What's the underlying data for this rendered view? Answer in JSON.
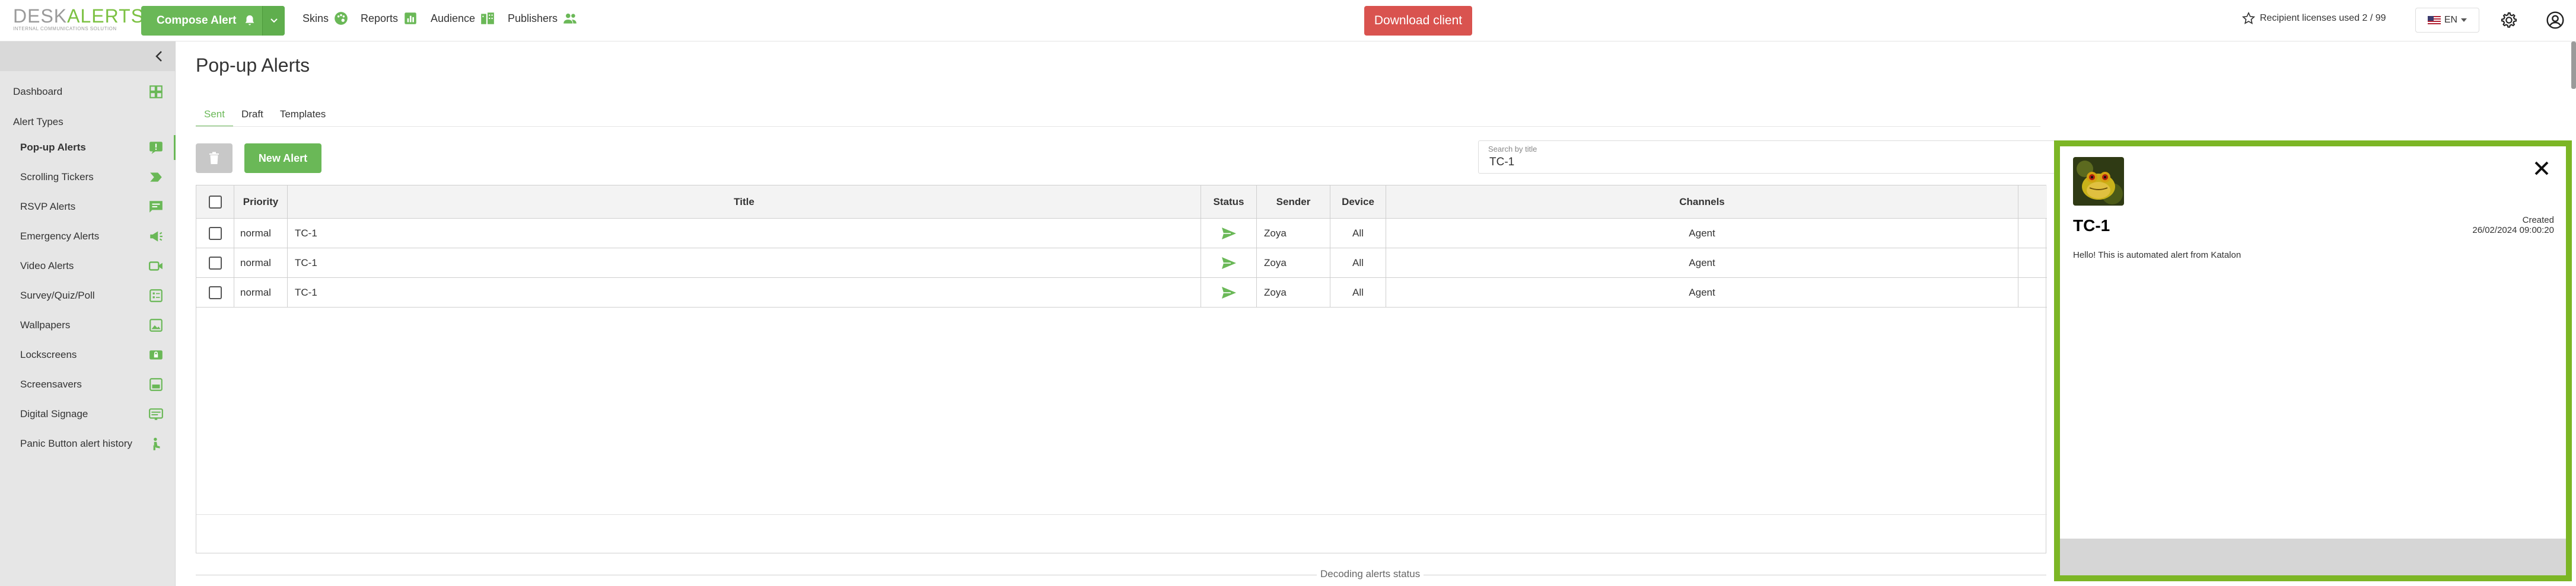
{
  "logo": {
    "desk": "DESK",
    "alerts": "ALERTS",
    "tagline": "INTERNAL COMMUNICATIONS SOLUTION"
  },
  "header": {
    "compose_label": "Compose Alert",
    "nav": [
      {
        "label": "Skins",
        "icon": "palette-icon"
      },
      {
        "label": "Reports",
        "icon": "chart-icon"
      },
      {
        "label": "Audience",
        "icon": "audience-icon"
      },
      {
        "label": "Publishers",
        "icon": "publishers-icon"
      }
    ],
    "download_label": "Download client",
    "licenses_label": "Recipient licenses used 2 / 99",
    "language": "EN",
    "colors": {
      "brand_green": "#6ab857",
      "download_red": "#d9534f",
      "popup_border": "#7cb625"
    }
  },
  "sidebar": {
    "dashboard": "Dashboard",
    "section_heading": "Alert Types",
    "items": [
      {
        "label": "Pop-up Alerts",
        "icon": "popup-alert-icon",
        "active": true
      },
      {
        "label": "Scrolling Tickers",
        "icon": "ticker-icon"
      },
      {
        "label": "RSVP Alerts",
        "icon": "rsvp-icon"
      },
      {
        "label": "Emergency Alerts",
        "icon": "megaphone-icon"
      },
      {
        "label": "Video Alerts",
        "icon": "video-icon"
      },
      {
        "label": "Survey/Quiz/Poll",
        "icon": "survey-icon"
      },
      {
        "label": "Wallpapers",
        "icon": "wallpaper-icon"
      },
      {
        "label": "Lockscreens",
        "icon": "lockscreen-icon"
      },
      {
        "label": "Screensavers",
        "icon": "screensaver-icon"
      },
      {
        "label": "Digital Signage",
        "icon": "signage-icon"
      },
      {
        "label": "Panic Button alert history",
        "icon": "panic-button-icon"
      }
    ]
  },
  "main": {
    "title": "Pop-up Alerts",
    "tabs": [
      {
        "label": "Sent",
        "active": true
      },
      {
        "label": "Draft"
      },
      {
        "label": "Templates"
      }
    ],
    "new_alert_label": "New Alert",
    "search": {
      "label": "Search by title",
      "value": "TC-1"
    },
    "table": {
      "columns": [
        "Priority",
        "Title",
        "Status",
        "Sender",
        "Device",
        "Channels"
      ],
      "rows": [
        {
          "priority": "normal",
          "title": "TC-1",
          "status": "sent-icon",
          "sender": "Zoya",
          "device": "All",
          "channels": "Agent"
        },
        {
          "priority": "normal",
          "title": "TC-1",
          "status": "sent-icon",
          "sender": "Zoya",
          "device": "All",
          "channels": "Agent"
        },
        {
          "priority": "normal",
          "title": "TC-1",
          "status": "sent-icon",
          "sender": "Zoya",
          "device": "All",
          "channels": "Agent"
        }
      ]
    },
    "decoding_label": "Decoding alerts status"
  },
  "popup": {
    "title": "TC-1",
    "created_label": "Created",
    "created_date": "26/02/2024 09:00:20",
    "body": "Hello! This is automated alert from Katalon"
  }
}
